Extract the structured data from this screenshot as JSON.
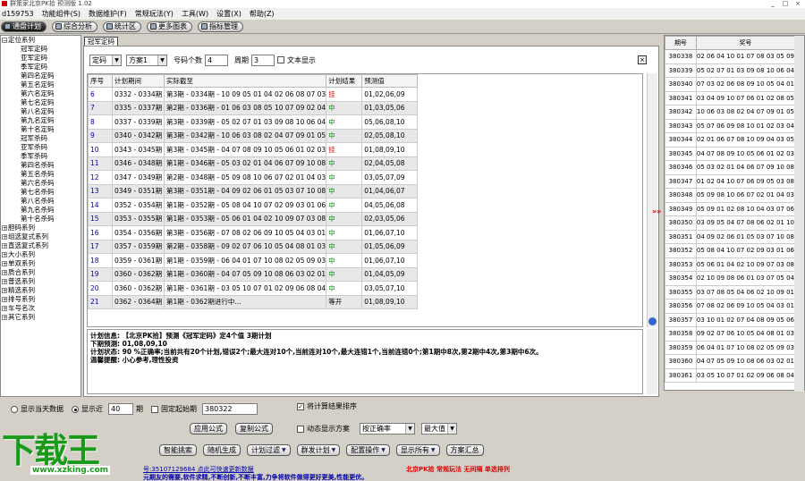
{
  "window": {
    "title": "群策家北京PK拾 预测版 1.02",
    "controls": [
      "_",
      "□",
      "×"
    ]
  },
  "menu": [
    "d159753",
    "功能组件(S)",
    "数据维护(F)",
    "常规玩法(Y)",
    "工具(W)",
    "设置(X)",
    "帮助(Z)"
  ],
  "toolbar": [
    {
      "label": "通盘计划",
      "icon": "plan-icon"
    },
    {
      "label": "综合分析",
      "icon": "analysis-icon"
    },
    {
      "label": "统计区",
      "icon": "stats-icon"
    },
    {
      "label": "更多图表",
      "icon": "chart-icon"
    },
    {
      "label": "指标管理",
      "icon": "index-icon"
    }
  ],
  "tree": {
    "groups": [
      {
        "label": "定位系列",
        "expanded": true,
        "children": [
          "冠军定码",
          "亚军定码",
          "季军定码",
          "第四名定码",
          "第五名定码",
          "第六名定码",
          "第七名定码",
          "第八名定码",
          "第九名定码",
          "第十名定码",
          "冠军杀码",
          "亚军杀码",
          "季军杀码",
          "第四名杀码",
          "第五名杀码",
          "第六名杀码",
          "第七名杀码",
          "第八名杀码",
          "第九名杀码",
          "第十名杀码"
        ]
      },
      {
        "label": "胆码系列"
      },
      {
        "label": "组选复式系列"
      },
      {
        "label": "直选复式系列"
      },
      {
        "label": "大小系列"
      },
      {
        "label": "单双系列"
      },
      {
        "label": "质合系列"
      },
      {
        "label": "普选系列"
      },
      {
        "label": "精选系列"
      },
      {
        "label": "排号系列"
      },
      {
        "label": "车号名次"
      },
      {
        "label": "其它系列"
      }
    ]
  },
  "main": {
    "tab": "冠军定码",
    "controls": {
      "type": "定码",
      "plan": "方案1",
      "count_label": "号码个数",
      "count": "4",
      "period_label": "周期",
      "period": "3",
      "text_display": "文本显示"
    },
    "columns": [
      "序号",
      "计划期间",
      "实际截至",
      "计划结果",
      "预测值"
    ],
    "rows": [
      {
        "no": "6",
        "period": "0332 - 0334期",
        "actual": "第3期 - 0334期 - 10 09 05 01 04 02 06 08 07 03",
        "result": "挂",
        "pred": "01,02,06,09"
      },
      {
        "no": "7",
        "period": "0335 - 0337期",
        "actual": "第2期 - 0336期 - 01 06 03 08 05 10 07 09 02 04",
        "result": "中",
        "pred": "01,03,05,06"
      },
      {
        "no": "8",
        "period": "0337 - 0339期",
        "actual": "第3期 - 0339期 - 05 02 07 01 03 09 08 10 06 04",
        "result": "中",
        "pred": "05,06,08,10"
      },
      {
        "no": "9",
        "period": "0340 - 0342期",
        "actual": "第3期 - 0342期 - 10 06 03 08 02 04 07 09 01 05",
        "result": "中",
        "pred": "02,05,08,10"
      },
      {
        "no": "10",
        "period": "0343 - 0345期",
        "actual": "第3期 - 0345期 - 04 07 08 09 10 05 06 01 02 03",
        "result": "挂",
        "pred": "01,08,09,10"
      },
      {
        "no": "11",
        "period": "0346 - 0348期",
        "actual": "第1期 - 0346期 - 05 03 02 01 04 06 07 09 10 08",
        "result": "中",
        "pred": "02,04,05,08"
      },
      {
        "no": "12",
        "period": "0347 - 0349期",
        "actual": "第2期 - 0348期 - 05 09 08 10 06 07 02 01 04 03",
        "result": "中",
        "pred": "03,05,07,09"
      },
      {
        "no": "13",
        "period": "0349 - 0351期",
        "actual": "第3期 - 0351期 - 04 09 02 06 01 05 03 07 10 08",
        "result": "中",
        "pred": "01,04,06,07"
      },
      {
        "no": "14",
        "period": "0352 - 0354期",
        "actual": "第1期 - 0352期 - 05 08 04 10 07 02 09 03 01 06",
        "result": "中",
        "pred": "04,05,06,08"
      },
      {
        "no": "15",
        "period": "0353 - 0355期",
        "actual": "第1期 - 0353期 - 05 06 01 04 02 10 09 07 03 08",
        "result": "中",
        "pred": "02,03,05,06"
      },
      {
        "no": "16",
        "period": "0354 - 0356期",
        "actual": "第3期 - 0356期 - 07 08 02 06 09 10 05 04 03 01",
        "result": "中",
        "pred": "01,06,07,10"
      },
      {
        "no": "17",
        "period": "0357 - 0359期",
        "actual": "第2期 - 0358期 - 09 02 07 06 10 05 04 08 01 03",
        "result": "中",
        "pred": "01,05,06,09"
      },
      {
        "no": "18",
        "period": "0359 - 0361期",
        "actual": "第1期 - 0359期 - 06 04 01 07 10 08 02 05 09 03",
        "result": "中",
        "pred": "01,06,07,10"
      },
      {
        "no": "19",
        "period": "0360 - 0362期",
        "actual": "第1期 - 0360期 - 04 07 05 09 10 08 06 03 02 01",
        "result": "中",
        "pred": "01,04,05,09"
      },
      {
        "no": "20",
        "period": "0360 - 0362期",
        "actual": "第1期 - 0361期 - 03 05 10 07 01 02 09 06 08 04",
        "result": "中",
        "pred": "03,05,07,10"
      },
      {
        "no": "21",
        "period": "0362 - 0364期",
        "actual": "第1期 - 0362期进行中...",
        "result": "等开",
        "pred": "01,08,09,10"
      }
    ],
    "info": [
      "计划信息: 【北京PK拾】预测《冠军定码》定4个值 3期计划",
      "下期预测: 01,08,09,10",
      "计划状态: 90 %正确率;当前共有20个计划,错误2个;最大连对10个,当前连对10个,最大连错1个,当前连错0个;第1期中8次,第2期中4次,第3期中6次。",
      "温馨提醒: 小心参考,理性投资"
    ]
  },
  "history": {
    "columns": [
      "期号",
      "奖号"
    ],
    "rows": [
      [
        "380338",
        "02 06 04 10 01 07 08 03 05 09"
      ],
      [
        "380339",
        "05 02 07 01 03 09 08 10 06 04"
      ],
      [
        "380340",
        "07 03 02 06 08 09 10 05 04 01"
      ],
      [
        "380341",
        "03 04 09 10 07 06 01 02 08 05"
      ],
      [
        "380342",
        "10 06 03 08 02 04 07 09 01 05"
      ],
      [
        "380343",
        "05 07 06 09 08 10 01 02 03 04"
      ],
      [
        "380344",
        "02 01 06 07 08 10 09 04 03 05"
      ],
      [
        "380345",
        "04 07 08 09 10 05 06 01 02 03"
      ],
      [
        "380346",
        "05 03 02 01 04 06 07 09 10 08"
      ],
      [
        "380347",
        "01 02 04 10 07 06 09 05 03 08"
      ],
      [
        "380348",
        "05 09 08 10 06 07 02 01 04 03"
      ],
      [
        "380349",
        "05 09 01 02 08 10 04 03 07 06"
      ],
      [
        "380350",
        "03 09 05 04 07 08 06 02 01 10"
      ],
      [
        "380351",
        "04 09 02 06 01 05 03 07 10 08"
      ],
      [
        "380352",
        "05 08 04 10 07 02 09 03 01 06"
      ],
      [
        "380353",
        "05 06 01 04 02 10 09 07 03 08"
      ],
      [
        "380354",
        "02 10 09 08 06 01 03 07 05 04"
      ],
      [
        "380355",
        "03 07 08 05 04 06 02 10 09 01"
      ],
      [
        "380356",
        "07 08 02 06 09 10 05 04 03 01"
      ],
      [
        "380357",
        "03 10 01 02 07 04 08 09 05 06"
      ],
      [
        "380358",
        "09 02 07 06 10 05 04 08 01 03"
      ],
      [
        "380359",
        "06 04 01 07 10 08 02 05 09 03"
      ],
      [
        "380360",
        "04 07 05 09 10 08 06 03 02 01"
      ],
      [
        "380361",
        "03 05 10 07 01 02 09 06 08 04"
      ]
    ]
  },
  "arrows": "»»",
  "bottom": {
    "show_today": "显示当天数据",
    "show_recent": "显示近",
    "recent_value": "40",
    "period_unit": "期",
    "fix_start": "固定起始期",
    "start_value": "380322",
    "sort_label": "将计算结果排序",
    "apply": "应用公式",
    "copy": "复制公式",
    "dynamic": "动态显示方案",
    "sort_select": "按正确率",
    "max_select": "最大值",
    "buttons": [
      {
        "label": "智能挑索"
      },
      {
        "label": "随机生成"
      },
      {
        "label": "计划过滤",
        "dd": "▼"
      },
      {
        "label": "群发计划",
        "dd": "▼"
      },
      {
        "label": "配置操作",
        "dd": "▼"
      },
      {
        "label": "显示所有",
        "dd": "▼"
      },
      {
        "label": "方案汇总"
      }
    ]
  },
  "logo": {
    "text": "下载王",
    "url": "www.xzking.com"
  },
  "status": {
    "left": "号:35107129684 点此可快速更新数据",
    "right": "北京PK拾  常规玩法  无间隔  单选排列",
    "line2": "元期友的需要,软件求精,不断创新,不断丰富,力争将软件做得更好更美,性能更优。"
  }
}
